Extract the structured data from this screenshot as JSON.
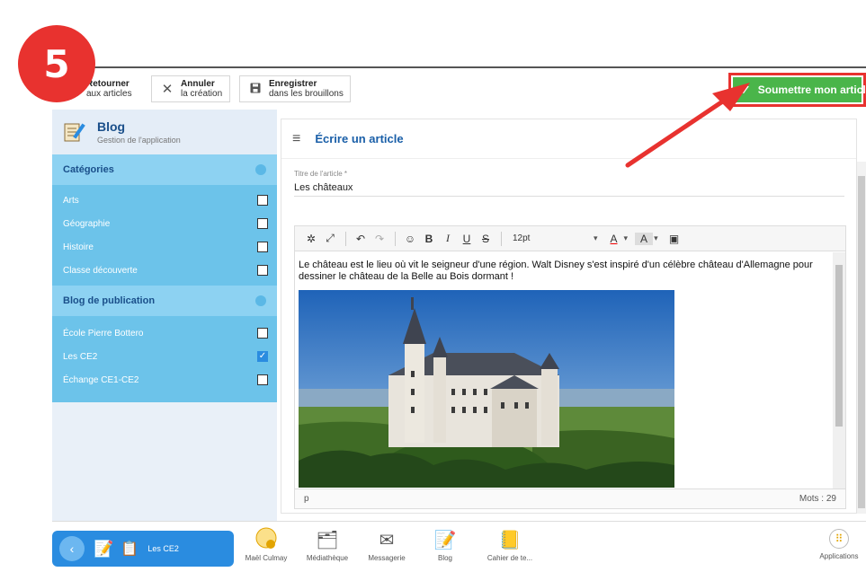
{
  "step": {
    "number": "5"
  },
  "toolbar": {
    "back": {
      "line1": "Retourner",
      "line2": "aux articles"
    },
    "cancel": {
      "line1": "Annuler",
      "line2": "la création"
    },
    "save": {
      "line1": "Enregistrer",
      "line2": "dans les brouillons"
    },
    "submit_label": "Soumettre mon article"
  },
  "sidebar": {
    "app_title": "Blog",
    "app_subtitle": "Gestion de l'application",
    "categories_title": "Catégories",
    "categories": [
      {
        "label": "Arts",
        "checked": false
      },
      {
        "label": "Géographie",
        "checked": false
      },
      {
        "label": "Histoire",
        "checked": false
      },
      {
        "label": "Classe découverte",
        "checked": false
      }
    ],
    "publication_title": "Blog de publication",
    "publications": [
      {
        "label": "École Pierre Bottero",
        "checked": false
      },
      {
        "label": "Les CE2",
        "checked": true
      },
      {
        "label": "Échange CE1-CE2",
        "checked": false
      }
    ]
  },
  "editor": {
    "title": "Écrire un article",
    "field_label": "Titre de l'article *",
    "article_title": "Les châteaux",
    "font_size": "12pt",
    "body_text": "Le château est le lieu où vit le seigneur d'une région. Walt Disney s'est inspiré d'un célèbre château d'Allemagne pour dessiner le château de la Belle au Bois dormant !",
    "status_path": "p",
    "word_count": "Mots : 29"
  },
  "taskbar": {
    "current_label": "Les CE2",
    "apps": [
      {
        "label": "Maël Culmay"
      },
      {
        "label": "Médiathèque"
      },
      {
        "label": "Messagerie"
      },
      {
        "label": "Blog"
      },
      {
        "label": "Cahier de te..."
      }
    ],
    "applications_label": "Applications"
  },
  "colors": {
    "accent_blue": "#2a8ce0",
    "sidebar_blue": "#6cc3ea",
    "submit_green": "#4ab54a",
    "highlight_red": "#e8322f"
  }
}
